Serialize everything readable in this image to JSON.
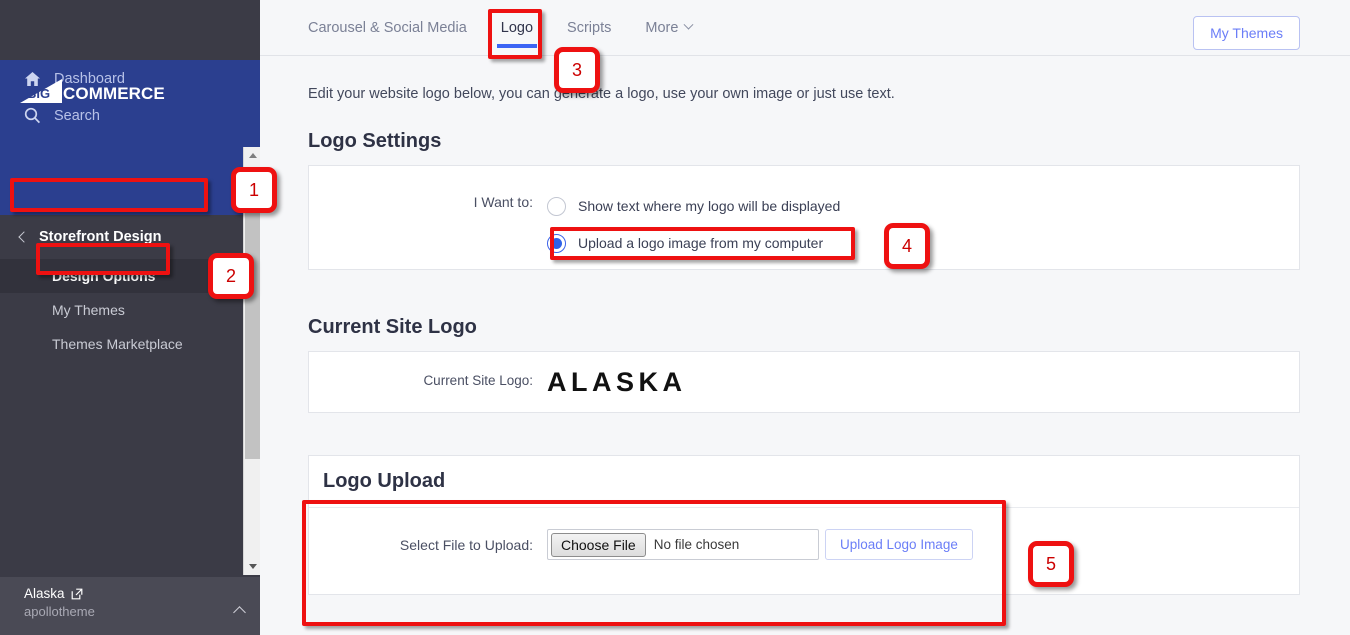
{
  "brand": {
    "mark_text": "BIG",
    "word": "COMMERCE"
  },
  "sidebar": {
    "links": [
      {
        "label": "Dashboard",
        "icon": "home-icon"
      },
      {
        "label": "Search",
        "icon": "search-icon"
      }
    ],
    "section": {
      "label": "Storefront Design",
      "icon": "chevron-left-icon"
    },
    "sub_items": [
      {
        "label": "Design Options",
        "active": true
      },
      {
        "label": "My Themes",
        "active": false
      },
      {
        "label": "Themes Marketplace",
        "active": false
      }
    ],
    "footer": {
      "store": "Alaska",
      "store_icon": "external-link-icon",
      "account": "apollotheme",
      "collapse_icon": "chevron-up-icon"
    }
  },
  "topbar": {
    "tabs": [
      {
        "label": "Carousel & Social Media",
        "active": false
      },
      {
        "label": "Logo",
        "active": true
      },
      {
        "label": "Scripts",
        "active": false
      },
      {
        "label": "More",
        "active": false,
        "caret": "chevron-down-icon"
      }
    ],
    "my_themes_button": "My Themes"
  },
  "main": {
    "intro": "Edit your website logo below, you can generate a logo, use your own image or just use text.",
    "logo_settings": {
      "title": "Logo Settings",
      "field_label": "I Want to:",
      "options": [
        {
          "label": "Show text where my logo will be displayed",
          "selected": false
        },
        {
          "label": "Upload a logo image from my computer",
          "selected": true
        }
      ]
    },
    "current_site_logo": {
      "title": "Current Site Logo",
      "field_label": "Current Site Logo:",
      "value": "ALASKA"
    },
    "logo_upload": {
      "title": "Logo Upload",
      "field_label": "Select File to Upload:",
      "choose_file_button": "Choose File",
      "file_status": "No file chosen",
      "upload_button": "Upload Logo Image"
    }
  },
  "annotations": {
    "badges": [
      {
        "number": "1"
      },
      {
        "number": "2"
      },
      {
        "number": "3"
      },
      {
        "number": "4"
      },
      {
        "number": "5"
      }
    ],
    "accent_color": "#ee1111"
  }
}
